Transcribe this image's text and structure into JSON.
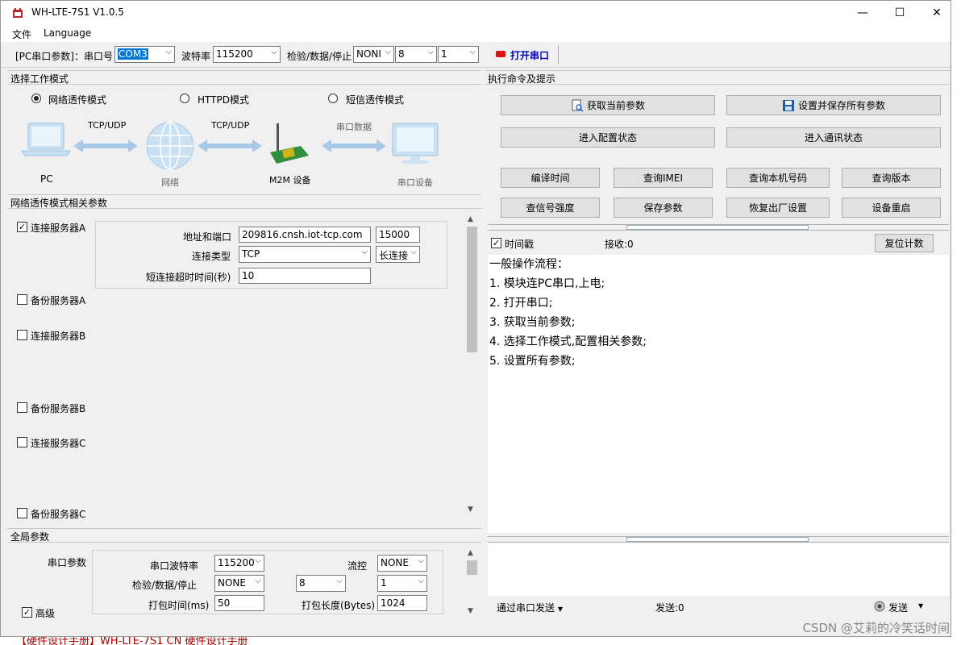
{
  "window": {
    "title": "WH-LTE-7S1 V1.0.5",
    "minimize": "—",
    "maximize": "☐",
    "close": "✕"
  },
  "menu": [
    "文件",
    "Language"
  ],
  "serial": {
    "label": "[PC串口参数]：串口号",
    "port": "COM3",
    "baud_label": "波特率",
    "baud": "115200",
    "parity_label": "检验/数据/停止",
    "parity": "NONI",
    "databits": "8",
    "stopbits": "1",
    "open_label": "打开串口",
    "led_color": "#e01010"
  },
  "mode": {
    "header": "选择工作模式",
    "options": [
      "网络透传模式",
      "HTTPD模式",
      "短信透传模式"
    ],
    "selected": 0,
    "diagram": {
      "pc": "PC",
      "link1": "TCP/UDP",
      "network": "网络",
      "link2": "TCP/UDP",
      "m2m": "M2M 设备",
      "link3": "串口数据",
      "serial_dev": "串口设备"
    }
  },
  "params": {
    "header": "网络透传模式相关参数",
    "server_a": {
      "label": "连接服务器A",
      "checked": true,
      "addr_label": "地址和端口",
      "addr": "209816.cnsh.iot-tcp.com",
      "port": "15000",
      "type_label": "连接类型",
      "type": "TCP",
      "conn": "长连接",
      "timeout_label": "短连接超时时间(秒)",
      "timeout": "10"
    },
    "backup_a": "备份服务器A",
    "server_b": "连接服务器B",
    "backup_b": "备份服务器B",
    "server_c": "连接服务器C",
    "backup_c": "备份服务器C"
  },
  "global": {
    "header": "全局参数",
    "serial_params": "串口参数",
    "baud_label": "串口波特率",
    "baud": "115200",
    "flow_label": "流控",
    "flow": "NONE",
    "parity_label": "检验/数据/停止",
    "parity": "NONE",
    "databits": "8",
    "stopbits": "1",
    "pack_time_label": "打包时间(ms)",
    "pack_time": "50",
    "pack_len_label": "打包长度(Bytes)",
    "pack_len": "1024",
    "advanced": "高级",
    "advanced_checked": true
  },
  "cmd": {
    "header": "执行命令及提示",
    "get_params": "获取当前参数",
    "save_all": "设置并保存所有参数",
    "enter_config": "进入配置状态",
    "enter_comm": "进入通讯状态",
    "row3": [
      "编译时间",
      "查询IMEI",
      "查询本机号码",
      "查询版本"
    ],
    "row4": [
      "查信号强度",
      "保存参数",
      "恢复出厂设置",
      "设备重启"
    ]
  },
  "log": {
    "timestamp_label": "时间戳",
    "timestamp_checked": true,
    "recv_label": "接收:0",
    "reset_count": "复位计数",
    "lines": [
      "一般操作流程：",
      "1. 模块连PC串口,上电;",
      "2. 打开串口;",
      "3. 获取当前参数;",
      "4. 选择工作模式,配置相关参数;",
      "5. 设置所有参数;"
    ]
  },
  "send": {
    "via": "通过串口发送",
    "sent": "发送:0",
    "send_btn": "发送"
  },
  "background": {
    "watermark": "CSDN @艾莉的冷笑话时间",
    "bottom_text": "【硬件设计手册】WH-LTE-7S1 CN 硬件设计手册"
  }
}
